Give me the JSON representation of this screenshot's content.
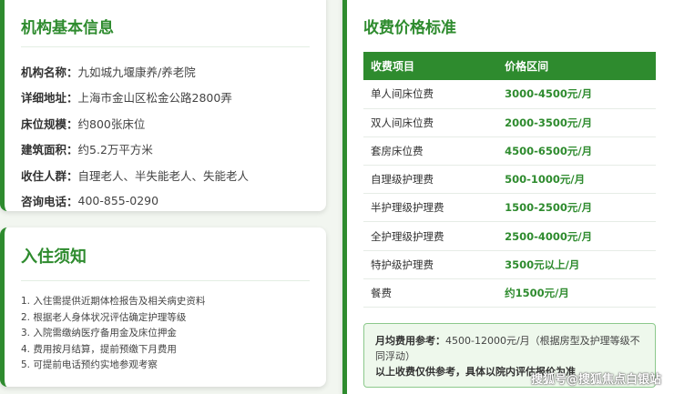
{
  "info": {
    "title": "机构基本信息",
    "rows": [
      {
        "label": "机构名称：",
        "value": "九如城九堰康养/养老院"
      },
      {
        "label": "详细地址：",
        "value": "上海市金山区松金公路2800弄"
      },
      {
        "label": "床位规模：",
        "value": "约800张床位"
      },
      {
        "label": "建筑面积：",
        "value": "约5.2万平方米"
      },
      {
        "label": "收住人群：",
        "value": "自理老人、半失能老人、失能老人"
      },
      {
        "label": "咨询电话：",
        "value": "400-855-0290"
      }
    ]
  },
  "admission": {
    "title": "入住须知",
    "items": [
      "1. 入住需提供近期体检报告及相关病史资料",
      "2. 根据老人身体状况评估确定护理等级",
      "3. 入院需缴纳医疗备用金及床位押金",
      "4. 费用按月结算，提前预缴下月费用",
      "5. 可提前电话预约实地参观考察"
    ]
  },
  "pricing": {
    "title": "收费价格标准",
    "headers": [
      "收费项目",
      "价格区间"
    ],
    "rows": [
      {
        "item": "单人间床位费",
        "price": "3000-4500元/月"
      },
      {
        "item": "双人间床位费",
        "price": "2000-3500元/月"
      },
      {
        "item": "套房床位费",
        "price": "4500-6500元/月"
      },
      {
        "item": "自理级护理费",
        "price": "500-1000元/月"
      },
      {
        "item": "半护理级护理费",
        "price": "1500-2500元/月"
      },
      {
        "item": "全护理级护理费",
        "price": "2500-4000元/月"
      },
      {
        "item": "特护级护理费",
        "price": "3500元以上/月"
      },
      {
        "item": "餐费",
        "price": "约1500元/月"
      }
    ],
    "note": {
      "label": "月均费用参考：",
      "text": "4500-12000元/月（根据房型及护理等级不同浮动）",
      "disclaimer": "以上收费仅供参考，具体以院内评估报价为准"
    }
  },
  "watermark": "搜狐号@搜狐焦点白银站",
  "colors": {
    "accent": "#2e8b2e",
    "note_bg": "#eef8ec"
  }
}
